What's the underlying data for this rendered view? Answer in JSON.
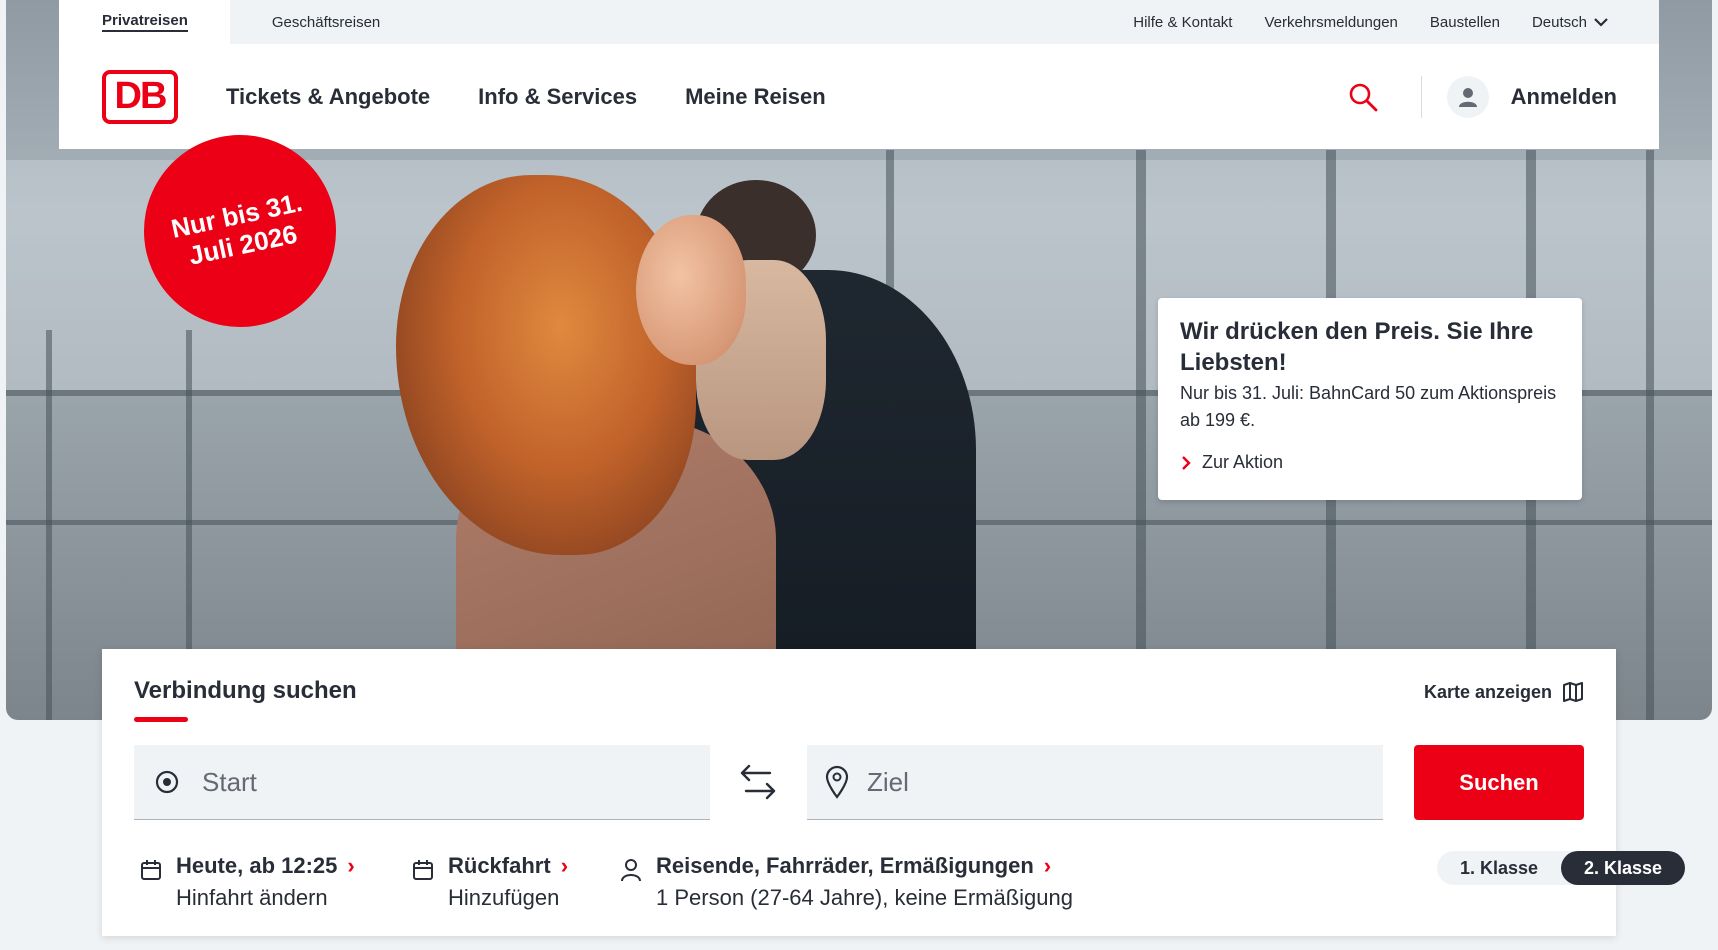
{
  "utility": {
    "tab_private": "Privatreisen",
    "tab_business": "Geschäftsreisen",
    "links": [
      "Hilfe & Kontakt",
      "Verkehrsmeldungen",
      "Baustellen"
    ],
    "language": "Deutsch"
  },
  "header": {
    "logo": "DB",
    "nav": [
      "Tickets & Angebote",
      "Info & Services",
      "Meine Reisen"
    ],
    "login": "Anmelden"
  },
  "badge": {
    "line1": "Nur bis 31.",
    "line2": "Juli 2026"
  },
  "promo": {
    "title": "Wir drücken den Preis. Sie Ihre Liebsten!",
    "text": "Nur bis 31. Juli: BahnCard 50 zum Aktions­preis ab 199 €.",
    "link": "Zur Aktion"
  },
  "search": {
    "tab": "Verbindung suchen",
    "map_link": "Karte anzeigen",
    "start_placeholder": "Start",
    "ziel_placeholder": "Ziel",
    "button": "Suchen",
    "outbound_title": "Heute, ab 12:25",
    "outbound_sub": "Hinfahrt ändern",
    "return_title": "Rückfahrt",
    "return_sub": "Hinzufügen",
    "travellers_title": "Reisende, Fahrräder, Ermäßigungen",
    "travellers_sub": "1 Person (27-64 Jahre), keine Ermäßigung",
    "class1": "1. Klasse",
    "class2": "2. Klasse",
    "selected_class": "2. Klasse"
  },
  "colors": {
    "brand_red": "#ec0016",
    "text_dark": "#282d37",
    "field_bg": "#f0f3f5"
  },
  "icons": [
    "search-icon",
    "user-icon",
    "chevron-down-icon",
    "chevron-right-icon",
    "map-icon",
    "location-target-icon",
    "swap-icon",
    "map-pin-icon",
    "calendar-icon",
    "person-icon"
  ]
}
